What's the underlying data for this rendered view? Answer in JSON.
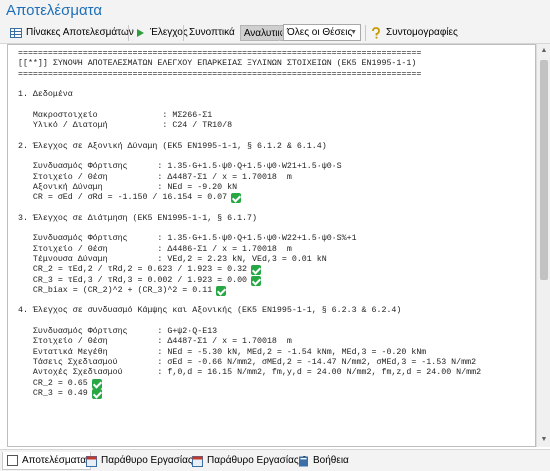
{
  "window": {
    "title": "Αποτελέσματα"
  },
  "toolbar": {
    "tables_label": "Πίνακες Αποτελεσμάτων",
    "check_label": "Έλεγχος",
    "summary_label": "Συνοπτικά",
    "detailed_label": "Αναλυτικά",
    "positions_value": "Όλες οι Θέσεις",
    "shortcuts_label": "Συντομογραφίες"
  },
  "report": {
    "lines": [
      {
        "text": "================================================================================="
      },
      {
        "text": "[[**]] ΣΥΝΟΨΗ ΑΠΟΤΕΛΕΣΜΑΤΩΝ ΕΛΕΓΧΟΥ ΕΠΑΡΚΕΙΑΣ ΞΥΛΙΝΩΝ ΣΤΟΙΧΕΙΩΝ (EK5 EN1995-1-1)"
      },
      {
        "text": "================================================================================="
      },
      {
        "text": ""
      },
      {
        "text": "1. Δεδομένα"
      },
      {
        "text": ""
      },
      {
        "text": "   Μακροστοιχείο             : ΜΣ266-Σ1"
      },
      {
        "text": "   Υλικό / Διατομή           : C24 / TR10/8"
      },
      {
        "text": ""
      },
      {
        "text": "2. Έλεγχος σε Αξονική Δύναμη (EK5 EN1995-1-1, § 6.1.2 & 6.1.4)"
      },
      {
        "text": ""
      },
      {
        "text": "   Συνδυασμός Φόρτισης      : 1.35·G+1.5·ψ0·Q+1.5·ψ0·W21+1.5·ψ0·S"
      },
      {
        "text": "   Στοιχείο / Θέση          : Δ4487-Σ1 / x = 1.70018  m"
      },
      {
        "text": "   Αξονική Δύναμη           : NEd = -9.20 kN"
      },
      {
        "text": "   CR = σEd / σRd = -1.150 / 16.154 = 0.07",
        "ok": true
      },
      {
        "text": ""
      },
      {
        "text": "3. Έλεγχος σε Διάτμηση (EK5 EN1995-1-1, § 6.1.7)"
      },
      {
        "text": ""
      },
      {
        "text": "   Συνδυασμός Φόρτισης      : 1.35·G+1.5·ψ0·Q+1.5·ψ0·W22+1.5·ψ0·S%+1"
      },
      {
        "text": "   Στοιχείο / Θέση          : Δ4486-Σ1 / x = 1.70018  m"
      },
      {
        "text": "   Τέμνουσα Δύναμη          : VEd,2 = 2.23 kN, VEd,3 = 0.01 kN"
      },
      {
        "text": "   CR_2 = τEd,2 / τRd,2 = 0.623 / 1.923 = 0.32",
        "ok": true
      },
      {
        "text": "   CR_3 = τEd,3 / τRd,3 = 0.002 / 1.923 = 0.00",
        "ok": true
      },
      {
        "text": "   CR_biax = (CR_2)^2 + (CR_3)^2 = 0.11",
        "ok": true
      },
      {
        "text": ""
      },
      {
        "text": "4. Έλεγχος σε συνδυασμό Κάμψης και Αξονικής (EK5 EN1995-1-1, § 6.2.3 & 6.2.4)"
      },
      {
        "text": ""
      },
      {
        "text": "   Συνδυασμός Φόρτισης      : G+ψ2·Q-E13"
      },
      {
        "text": "   Στοιχείο / Θέση          : Δ4487-Σ1 / x = 1.70018  m"
      },
      {
        "text": "   Εντατικά Μεγέθη          : NEd = -5.30 kN, MEd,2 = -1.54 kNm, MEd,3 = -0.20 kNm"
      },
      {
        "text": "   Τάσεις Σχεδιασμού        : σEd = -0.66 N/mm2, σMEd,2 = -14.47 N/mm2, σMEd,3 = -1.53 N/mm2"
      },
      {
        "text": "   Αντοχές Σχεδιασμού       : f,0,d = 16.15 N/mm2, fm,y,d = 24.00 N/mm2, fm,z,d = 24.00 N/mm2"
      },
      {
        "text": "   CR_2 = 0.65",
        "ok": true
      },
      {
        "text": "   CR_3 = 0.49",
        "ok": true
      }
    ]
  },
  "tabs": [
    {
      "label": "Αποτελέσματα"
    },
    {
      "label": "Παράθυρο Εργασίας 1"
    },
    {
      "label": "Παράθυρο Εργασίας 2"
    },
    {
      "label": "Βοήθεια"
    }
  ],
  "colors": {
    "title": "#1e6fb7",
    "ok": "#27a844"
  }
}
